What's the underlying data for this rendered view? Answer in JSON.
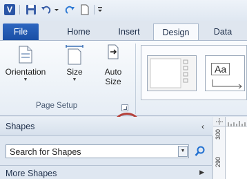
{
  "quick_access": {
    "app_logo": "V",
    "items": [
      "save-icon",
      "undo-icon",
      "dropdown-icon",
      "redo-icon",
      "new-page-icon",
      "customize-icon"
    ]
  },
  "tabs": [
    {
      "label": "File"
    },
    {
      "label": "Home"
    },
    {
      "label": "Insert"
    },
    {
      "label": "Design"
    },
    {
      "label": "Data"
    }
  ],
  "ribbon": {
    "page_setup": {
      "orientation_label": "Orientation",
      "size_label": "Size",
      "auto_size_label": "Auto Size",
      "group_label": "Page Setup"
    },
    "themes": {
      "theme_sample_text": "Aa"
    }
  },
  "shapes_pane": {
    "title": "Shapes",
    "collapse": "‹",
    "search_value": "Search for Shapes",
    "more_shapes": "More Shapes",
    "more_arrow": "▶"
  },
  "canvas": {
    "vruler_labels": [
      "300",
      "290"
    ]
  },
  "colors": {
    "file_tab": "#2d66c0",
    "highlight": "#b5413a",
    "search_icon": "#1f6fd0"
  }
}
